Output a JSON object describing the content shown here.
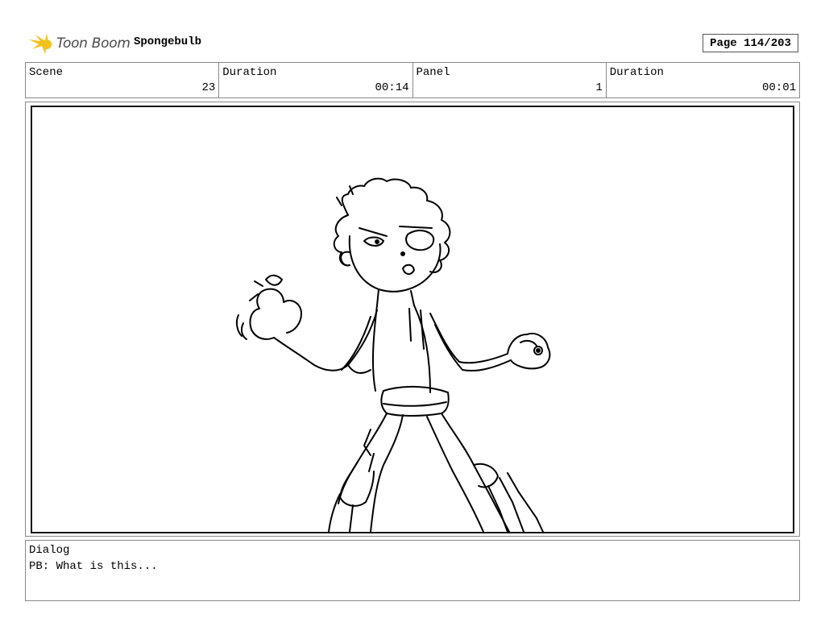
{
  "header": {
    "logo_text": "Toon Boom",
    "project_name": "Spongebulb",
    "page_label": "Page 114/203"
  },
  "info": {
    "scene_label": "Scene",
    "scene_value": "23",
    "scene_duration_label": "Duration",
    "scene_duration_value": "00:14",
    "panel_label": "Panel",
    "panel_value": "1",
    "panel_duration_label": "Duration",
    "panel_duration_value": "00:01"
  },
  "panel": {
    "icon": "character-sketch"
  },
  "dialog": {
    "label": "Dialog",
    "text": "PB: What is this..."
  },
  "colors": {
    "logo_yellow": "#f2c21b",
    "logo_text": "#4a4a4a"
  }
}
